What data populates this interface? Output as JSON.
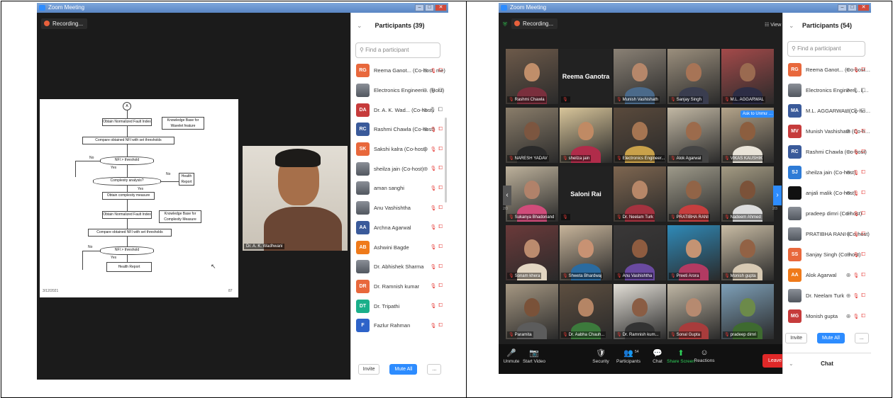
{
  "left_window": {
    "title": "Zoom Meeting",
    "recording": "Recording...",
    "participants_title": "Participants (39)",
    "search_placeholder": "Find a participant",
    "speaker_name": "Dr. A. K. Wadhwani",
    "slide": {
      "top_circle": "A",
      "boxes": [
        "Obtain Normalized Fault Index",
        "Knowledge Base for Wavelet feature",
        "Compare obtained NFI with set thresholds",
        "NFI > threshold",
        "Complexity analysis?",
        "Health Report",
        "Obtain complexity measure",
        "Obtain Normalized Fault Index",
        "Knowledge Base for Complexity Measure",
        "Compare obtained NFI with set thresholds",
        "NFI > threshold",
        "Health Report"
      ],
      "labels": {
        "no1": "No",
        "yes1": "Yes",
        "no2": "No",
        "yes2": "Yes",
        "no3": "No",
        "yes3": "Yes"
      },
      "footer_left": "3/12/2021",
      "footer_right": "87"
    },
    "participants": [
      {
        "initials": "RG",
        "color": "#e8683c",
        "name": "Reema Ganot... (Co-host, me)"
      },
      {
        "initials": "",
        "color": "",
        "name": "Electronics Engineeri... (Host)"
      },
      {
        "initials": "DA",
        "color": "#c63b3b",
        "name": "Dr. A. K. Wad... (Co-host)"
      },
      {
        "initials": "RC",
        "color": "#3a5a9a",
        "name": "Rashmi Chawla (Co-host)"
      },
      {
        "initials": "SK",
        "color": "#e8683c",
        "name": "Sakshi kalra (Co-host)"
      },
      {
        "initials": "",
        "color": "",
        "name": "sheilza jain (Co-host)"
      },
      {
        "initials": "",
        "color": "",
        "name": "aman sanghi"
      },
      {
        "initials": "",
        "color": "",
        "name": "Anu Vashishtha"
      },
      {
        "initials": "AA",
        "color": "#3a5a9a",
        "name": "Archna Agarwal"
      },
      {
        "initials": "AB",
        "color": "#ef7a1a",
        "name": "Ashwini Bagde"
      },
      {
        "initials": "",
        "color": "",
        "name": "Dr. Abhishek Sharma"
      },
      {
        "initials": "DR",
        "color": "#e8683c",
        "name": "Dr. Ramnish kumar"
      },
      {
        "initials": "DT",
        "color": "#1aaf8a",
        "name": "Dr. Tripathi"
      },
      {
        "initials": "F",
        "color": "#2e63c9",
        "name": "Fazlur Rahman"
      }
    ],
    "footer": {
      "invite": "Invite",
      "mute_all": "Mute All",
      "more": "..."
    }
  },
  "right_window": {
    "title": "Zoom Meeting",
    "recording": "Recording...",
    "view_label": "View",
    "participants_title": "Participants (54)",
    "search_placeholder": "Find a participant",
    "ask_unmute": "Ask to Unmute",
    "page_left": "2/3",
    "page_right": "2/3",
    "tiles": [
      {
        "name": "Rashmi Chawla",
        "big": ""
      },
      {
        "name": "",
        "big": "Reema Ganotra"
      },
      {
        "name": "Munish Vashishath",
        "big": ""
      },
      {
        "name": "Sanjay Singh",
        "big": ""
      },
      {
        "name": "M.L. AGGARWAL",
        "big": ""
      },
      {
        "name": "NARESH YADAV",
        "big": ""
      },
      {
        "name": "sheilza jain",
        "big": ""
      },
      {
        "name": "Electronics Engineer...",
        "big": ""
      },
      {
        "name": "Alok Agarwal",
        "big": ""
      },
      {
        "name": "VIKAS KAUSHIK",
        "big": ""
      },
      {
        "name": "Sukanya Bhadoriand",
        "big": ""
      },
      {
        "name": "",
        "big": "Saloni Rai"
      },
      {
        "name": "Dr. Neelam Turk",
        "big": ""
      },
      {
        "name": "PRATIBHA RANI",
        "big": ""
      },
      {
        "name": "Nadeem Ahmed",
        "big": ""
      },
      {
        "name": "Sonam khera",
        "big": ""
      },
      {
        "name": "Shweta Bhardwaj",
        "big": ""
      },
      {
        "name": "Anu Vashishtha",
        "big": ""
      },
      {
        "name": "Preeti Arora",
        "big": ""
      },
      {
        "name": "Monish gupta",
        "big": ""
      },
      {
        "name": "Paramita",
        "big": ""
      },
      {
        "name": "Dr. Aabha Chauh...",
        "big": ""
      },
      {
        "name": "Dr. Ramnish kum...",
        "big": ""
      },
      {
        "name": "Sonal Gupta",
        "big": ""
      },
      {
        "name": "pradeep dimri",
        "big": ""
      }
    ],
    "participants": [
      {
        "initials": "RG",
        "color": "#e8683c",
        "name": "Reema Ganot... (Co-host, me)"
      },
      {
        "initials": "",
        "color": "",
        "name": "Electronics Engineeri... (Host)"
      },
      {
        "initials": "MA",
        "color": "#3a5a9a",
        "name": "M.L. AGGARWAL (Co-host)"
      },
      {
        "initials": "MV",
        "color": "#c63b3b",
        "name": "Munish Vashishath (Co-host)"
      },
      {
        "initials": "RC",
        "color": "#3a5a9a",
        "name": "Rashmi Chawla (Co-host)"
      },
      {
        "initials": "SJ",
        "color": "#2e7bd6",
        "name": "sheilza jain (Co-host)"
      },
      {
        "initials": "",
        "color": "#111",
        "name": "anjali malik (Co-host)"
      },
      {
        "initials": "",
        "color": "",
        "name": "pradeep dimri (Co-host)"
      },
      {
        "initials": "",
        "color": "",
        "name": "PRATIBHA RANI (Co-host)"
      },
      {
        "initials": "SS",
        "color": "#e8683c",
        "name": "Sanjay Singh (Co-host)"
      },
      {
        "initials": "AA",
        "color": "#ef7a1a",
        "name": "Alok Agarwal"
      },
      {
        "initials": "",
        "color": "",
        "name": "Dr. Neelam Turk"
      },
      {
        "initials": "MG",
        "color": "#c63b3b",
        "name": "Monish gupta"
      }
    ],
    "footer": {
      "invite": "Invite",
      "mute_all": "Mute All",
      "more": "..."
    },
    "chat_title": "Chat",
    "toolbar": [
      {
        "label": "Unmute",
        "glyph": "🎤"
      },
      {
        "label": "Start Video",
        "glyph": "📷"
      },
      {
        "label": "Security",
        "glyph": "🛡"
      },
      {
        "label": "Participants",
        "glyph": "👥"
      },
      {
        "label": "Chat",
        "glyph": "💬"
      },
      {
        "label": "Share Screen",
        "glyph": "⬆"
      },
      {
        "label": "Reactions",
        "glyph": "☺"
      }
    ],
    "participants_badge": "54",
    "leave_label": "Leave"
  }
}
